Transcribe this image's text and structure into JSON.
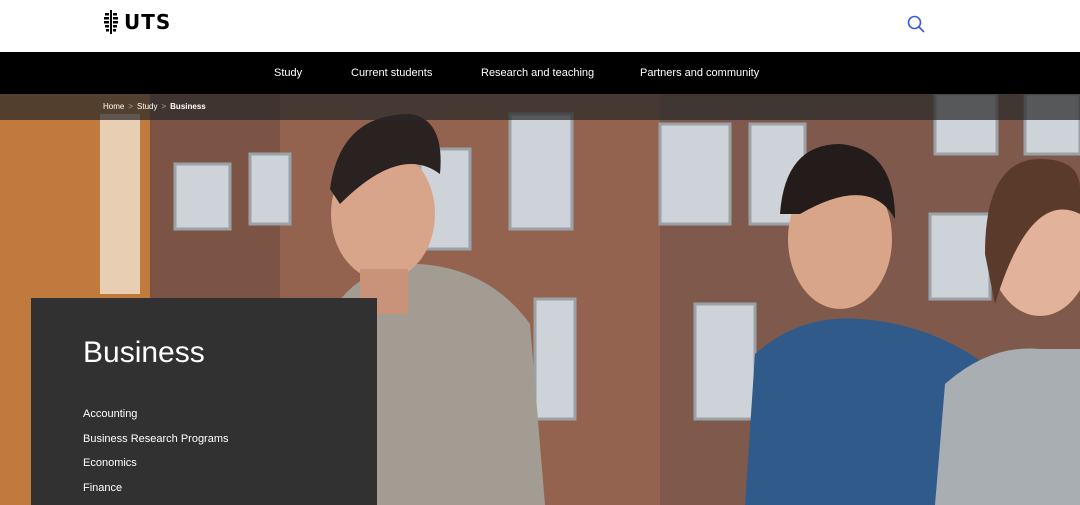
{
  "header": {
    "logo_text": "UTS",
    "logo_icon": "uts-crest-icon",
    "search_icon": "search-icon"
  },
  "nav": {
    "items": [
      {
        "label": "Study"
      },
      {
        "label": "Current students"
      },
      {
        "label": "Research and teaching"
      },
      {
        "label": "Partners and community"
      }
    ]
  },
  "breadcrumb": {
    "items": [
      "Home",
      "Study",
      "Business"
    ],
    "separator": ">"
  },
  "hero": {
    "title": "Business",
    "links": [
      "Accounting",
      "Business Research Programs",
      "Economics",
      "Finance"
    ]
  },
  "colors": {
    "nav_bg": "#000000",
    "panel_bg": "#313131",
    "search_icon": "#3b5bdb"
  }
}
